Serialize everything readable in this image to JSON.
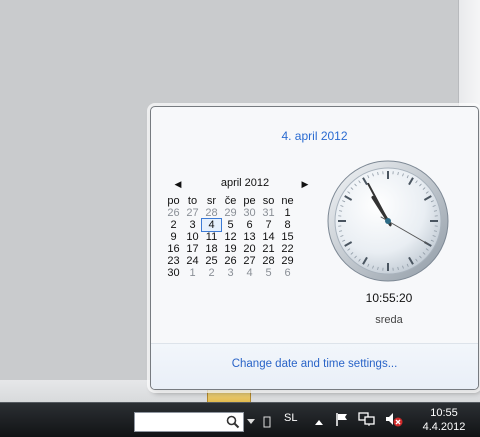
{
  "flyout": {
    "date_title": "4. april 2012",
    "month_label": "april 2012",
    "prev_glyph": "◀",
    "next_glyph": "▶",
    "weekdays": [
      "po",
      "to",
      "sr",
      "če",
      "pe",
      "so",
      "ne"
    ],
    "weeks": [
      [
        "26",
        "27",
        "28",
        "29",
        "30",
        "31",
        "1"
      ],
      [
        "2",
        "3",
        "4",
        "5",
        "6",
        "7",
        "8"
      ],
      [
        "9",
        "10",
        "11",
        "12",
        "13",
        "14",
        "15"
      ],
      [
        "16",
        "17",
        "18",
        "19",
        "20",
        "21",
        "22"
      ],
      [
        "23",
        "24",
        "25",
        "26",
        "27",
        "28",
        "29"
      ],
      [
        "30",
        "1",
        "2",
        "3",
        "4",
        "5",
        "6"
      ]
    ],
    "time_text": "10:55:20",
    "day_text": "sreda",
    "settings_link": "Change date and time settings..."
  },
  "clock": {
    "hour": 10,
    "minute": 55,
    "second": 20
  },
  "taskbar": {
    "language": "SL",
    "clock_time": "10:55",
    "clock_date": "4.4.2012"
  },
  "colors": {
    "accent": "#2a6bd1",
    "taskbar": "#1c1f22",
    "today_outline": "#3d7bd6"
  },
  "icons": [
    "search-icon",
    "show-hidden-icons-icon",
    "action-center-flag-icon",
    "network-icon",
    "speaker-muted-icon",
    "pin-icon"
  ]
}
